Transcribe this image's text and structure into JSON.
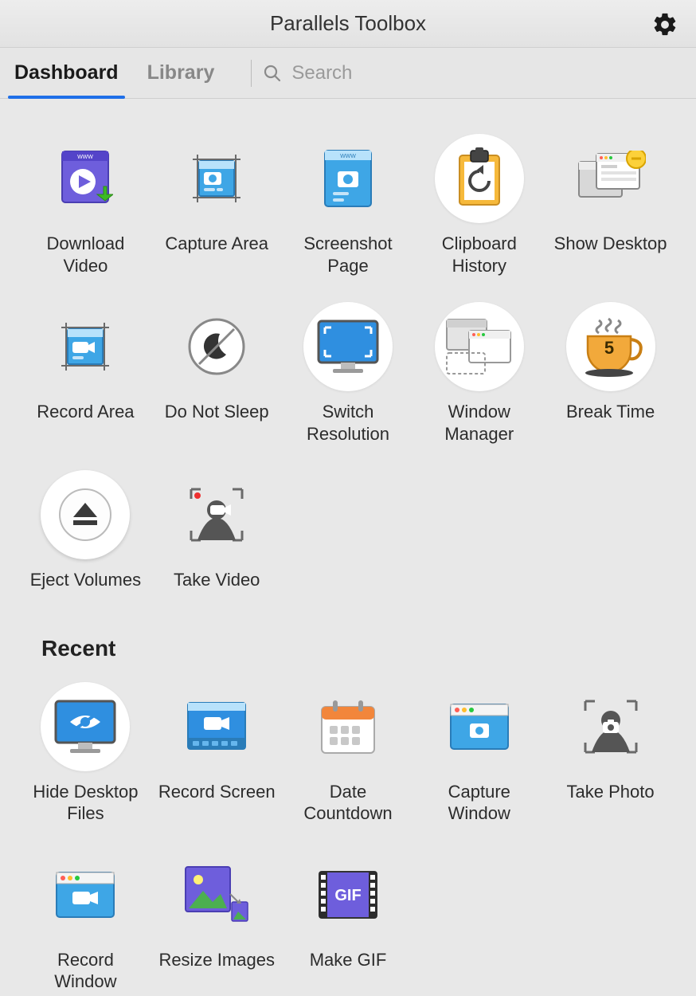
{
  "header": {
    "title": "Parallels Toolbox"
  },
  "tabs": {
    "dashboard": "Dashboard",
    "library": "Library"
  },
  "search": {
    "placeholder": "Search"
  },
  "section_recent": "Recent",
  "tools": {
    "download_video": "Download Video",
    "capture_area": "Capture Area",
    "screenshot_page": "Screenshot Page",
    "clipboard_history": "Clipboard History",
    "show_desktop": "Show Desktop",
    "record_area": "Record Area",
    "do_not_sleep": "Do Not Sleep",
    "switch_resolution": "Switch Resolution",
    "window_manager": "Window Manager",
    "break_time": "Break Time",
    "eject_volumes": "Eject Volumes",
    "take_video": "Take Video",
    "hide_desktop_files": "Hide Desktop Files",
    "record_screen": "Record Screen",
    "date_countdown": "Date Countdown",
    "capture_window": "Capture Window",
    "take_photo": "Take Photo",
    "record_window": "Record Window",
    "resize_images": "Resize Images",
    "make_gif": "Make GIF"
  },
  "break_time_value": "5"
}
